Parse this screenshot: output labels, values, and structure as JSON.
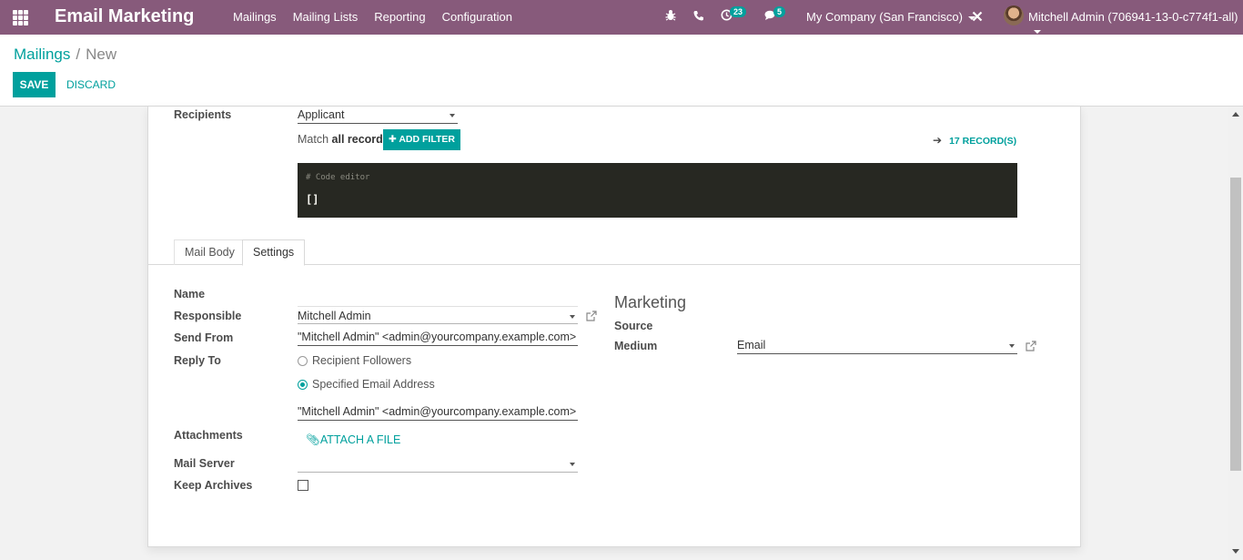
{
  "navbar": {
    "app_title": "Email Marketing",
    "menu": [
      "Mailings",
      "Mailing Lists",
      "Reporting",
      "Configuration"
    ],
    "activity_badge": "23",
    "messages_badge": "5",
    "company": "My Company (San Francisco)",
    "user": "Mitchell Admin (706941-13-0-c774f1-all)"
  },
  "breadcrumb": {
    "parent": "Mailings",
    "separator": "/",
    "current": "New"
  },
  "buttons": {
    "save": "SAVE",
    "discard": "DISCARD"
  },
  "recipients": {
    "label": "Recipients",
    "value": "Applicant",
    "match_prefix": "Match",
    "match_bold": "all records",
    "add_filter": "ADD FILTER",
    "records": "17 RECORD(S)",
    "code_comment": "# Code editor",
    "code_value": "[]"
  },
  "tabs": {
    "mail_body": "Mail Body",
    "settings": "Settings"
  },
  "settings": {
    "name_label": "Name",
    "responsible_label": "Responsible",
    "responsible_value": "Mitchell Admin",
    "send_from_label": "Send From",
    "send_from_value": "\"Mitchell Admin\" <admin@yourcompany.example.com>",
    "reply_to_label": "Reply To",
    "reply_option_1": "Recipient Followers",
    "reply_option_2": "Specified Email Address",
    "reply_to_value": "\"Mitchell Admin\" <admin@yourcompany.example.com>",
    "attachments_label": "Attachments",
    "attach_file": "ATTACH A FILE",
    "mail_server_label": "Mail Server",
    "keep_archives_label": "Keep Archives"
  },
  "marketing": {
    "title": "Marketing",
    "source_label": "Source",
    "medium_label": "Medium",
    "medium_value": "Email"
  },
  "colors": {
    "navbar": "#875a7b",
    "accent": "#00a09d"
  }
}
